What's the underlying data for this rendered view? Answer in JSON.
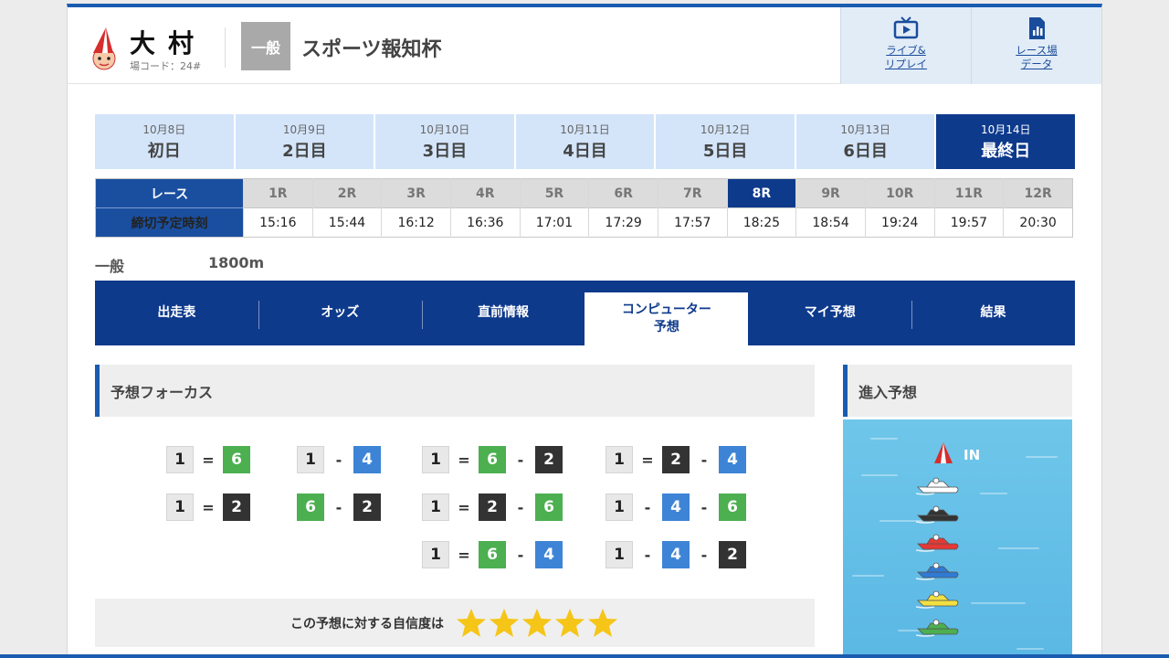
{
  "header": {
    "venue_name": "大村",
    "venue_code": "場コード：24#",
    "grade": "一般",
    "race_title": "スポーツ報知杯",
    "buttons": [
      {
        "label": "ライブ&\nリプレイ",
        "icon": "tv-icon"
      },
      {
        "label": "レース場\nデータ",
        "icon": "data-icon"
      }
    ]
  },
  "days": [
    {
      "date": "10月8日",
      "name": "初日",
      "active": false
    },
    {
      "date": "10月9日",
      "name": "2日目",
      "active": false
    },
    {
      "date": "10月10日",
      "name": "3日目",
      "active": false
    },
    {
      "date": "10月11日",
      "name": "4日目",
      "active": false
    },
    {
      "date": "10月12日",
      "name": "5日目",
      "active": false
    },
    {
      "date": "10月13日",
      "name": "6日目",
      "active": false
    },
    {
      "date": "10月14日",
      "name": "最終日",
      "active": true
    }
  ],
  "race_table": {
    "row_labels": [
      "レース",
      "締切予定時刻"
    ],
    "races": [
      "1R",
      "2R",
      "3R",
      "4R",
      "5R",
      "6R",
      "7R",
      "8R",
      "9R",
      "10R",
      "11R",
      "12R"
    ],
    "times": [
      "15:16",
      "15:44",
      "16:12",
      "16:36",
      "17:01",
      "17:29",
      "17:57",
      "18:25",
      "18:54",
      "19:24",
      "19:57",
      "20:30"
    ],
    "active_index": 7
  },
  "race_info": {
    "class": "一般",
    "distance": "1800m"
  },
  "tabs": [
    {
      "label": "出走表",
      "active": false
    },
    {
      "label": "オッズ",
      "active": false
    },
    {
      "label": "直前情報",
      "active": false
    },
    {
      "label": "コンピューター\n予想",
      "active": true
    },
    {
      "label": "マイ予想",
      "active": false
    },
    {
      "label": "結果",
      "active": false
    }
  ],
  "forecast": {
    "title": "予想フォーカス",
    "combos": [
      {
        "boats": [
          "1",
          "6"
        ],
        "seps": [
          "="
        ]
      },
      {
        "boats": [
          "1",
          "4"
        ],
        "seps": [
          "-"
        ]
      },
      {
        "boats": [
          "1",
          "6",
          "2"
        ],
        "seps": [
          "=",
          "-"
        ]
      },
      {
        "boats": [
          "1",
          "2",
          "4"
        ],
        "seps": [
          "=",
          "-"
        ]
      },
      {
        "boats": [
          "1",
          "2"
        ],
        "seps": [
          "="
        ]
      },
      {
        "boats": [
          "6",
          "2"
        ],
        "seps": [
          "-"
        ]
      },
      {
        "boats": [
          "1",
          "2",
          "6"
        ],
        "seps": [
          "=",
          "-"
        ]
      },
      {
        "boats": [
          "1",
          "4",
          "6"
        ],
        "seps": [
          "-",
          "-"
        ]
      },
      {
        "boats": [
          "1",
          "6",
          "4"
        ],
        "seps": [
          "=",
          "-"
        ]
      },
      {
        "boats": [
          "1",
          "4",
          "2"
        ],
        "seps": [
          "-",
          "-"
        ]
      }
    ],
    "confidence_label": "この予想に対する自信度は",
    "confidence_stars": 5
  },
  "entry": {
    "title": "進入予想",
    "in_label": "IN",
    "boat_colors": [
      "#ffffff",
      "#333333",
      "#e53935",
      "#2f7bd3",
      "#f2e040",
      "#4caf50"
    ]
  },
  "colors": {
    "brand": "#0e3a8c",
    "accent": "#1a5cb0",
    "star": "#f5c518"
  }
}
